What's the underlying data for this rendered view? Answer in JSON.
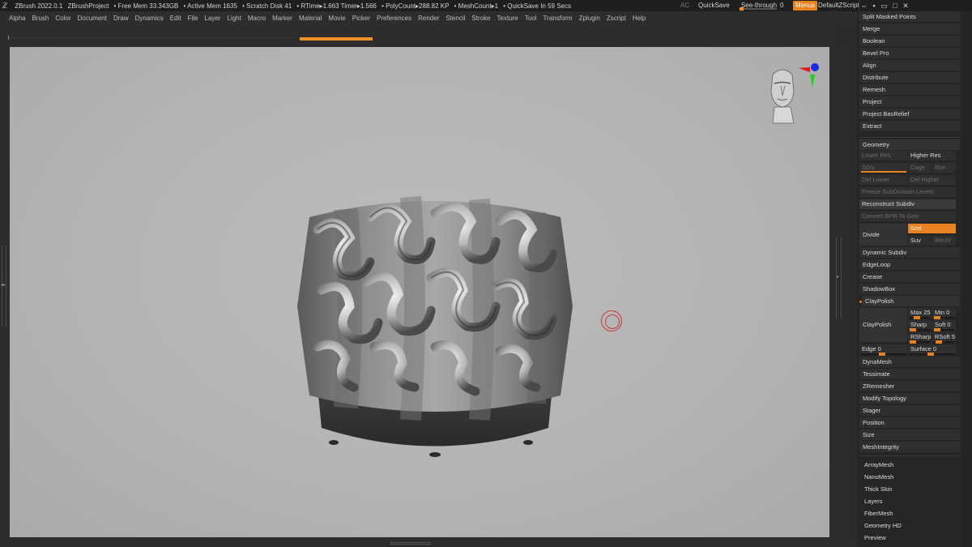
{
  "titlebar": {
    "app": "ZBrush 2022.0.1",
    "project": "ZBrushProject",
    "free_mem": "• Free Mem 33.343GB",
    "active_mem": "• Active Mem 1635",
    "scratch": "• Scratch Disk 41",
    "rtime": "• RTime▸1.663 Timer▸1.566",
    "polycount": "• PolyCount▸288.82 KP",
    "meshcount": "• MeshCount▸1",
    "quicksave_timer": "• QuickSave In 59 Secs",
    "ac": "AC",
    "quicksave": "QuickSave",
    "see_through": "See-through",
    "see_through_value": "0",
    "menus": "Menus",
    "default_zscript": "DefaultZScript"
  },
  "menubar": [
    "Alpha",
    "Brush",
    "Color",
    "Document",
    "Draw",
    "Dynamics",
    "Edit",
    "File",
    "Layer",
    "Light",
    "Macro",
    "Marker",
    "Material",
    "Movie",
    "Picker",
    "Preferences",
    "Render",
    "Stencil",
    "Stroke",
    "Texture",
    "Tool",
    "Transform",
    "Zplugin",
    "Zscript",
    "Help"
  ],
  "panel": {
    "subtools_top": [
      "Split Masked Points",
      "Merge",
      "Boolean",
      "Bevel Pro",
      "Align",
      "Distribute",
      "Remesh",
      "Project",
      "Project BasRelief",
      "Extract"
    ],
    "geometry_header": "Geometry",
    "lower_res": "Lower Res",
    "higher_res": "Higher Res",
    "sdiv": "SDiv",
    "cage": "Cage",
    "rstr": "Rstr",
    "del_lower": "Del Lower",
    "del_higher": "Del Higher",
    "freeze_subdiv": "Freeze SubDivision Levels",
    "reconstruct_subdiv": "Reconstruct Subdiv",
    "convert_bpr": "Convert BPR To Geo",
    "divide": "Divide",
    "smt": "Smt",
    "suv": "Suv",
    "reuv": "ReUV",
    "geometry_items": [
      "Dynamic Subdiv",
      "EdgeLoop",
      "Crease",
      "ShadowBox"
    ],
    "claypolish_header": "ClayPolish",
    "claypolish_btn": "ClayPolish",
    "max_label": "Max 25",
    "min_label": "Min 0",
    "sharp_label": "Sharp",
    "soft_label": "Soft 0",
    "rsharp_label": "RSharp",
    "rsoft_label": "RSoft 5",
    "edge_label": "Edge 0",
    "surface_label": "Surface 0",
    "geometry_items2": [
      "DynaMesh",
      "Tessimate",
      "ZRemesher",
      "Modify Topology",
      "Stager",
      "Position",
      "Size",
      "MeshIntegrity"
    ],
    "tool_items": [
      "ArrayMesh",
      "NanoMesh",
      "Thick Skin",
      "Layers",
      "FiberMesh",
      "Geometry HD",
      "Preview"
    ]
  },
  "colors": {
    "accent": "#e8811f",
    "canvas_bg": "#b5b5b5",
    "panel_bg": "#262626"
  }
}
